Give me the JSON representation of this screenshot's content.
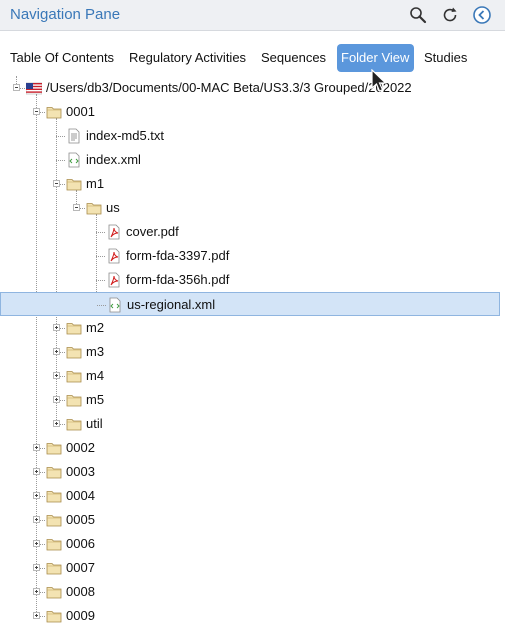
{
  "pane": {
    "title": "Navigation Pane"
  },
  "header_icons": [
    "search-icon",
    "refresh-icon",
    "back-circle-icon"
  ],
  "accent": "#5b97dc",
  "tabs": [
    {
      "label": "Table Of Contents",
      "active": false
    },
    {
      "label": "Regulatory Activities",
      "active": false
    },
    {
      "label": "Sequences",
      "active": false
    },
    {
      "label": "Folder View",
      "active": true
    },
    {
      "label": "Studies",
      "active": false
    }
  ],
  "tree": [
    {
      "label": "/Users/db3/Documents/00-MAC Beta/US3.3/3 Grouped/202022",
      "depth": 0,
      "kind": "us-flag",
      "expanded": true
    },
    {
      "label": "0001",
      "depth": 1,
      "kind": "folder",
      "expanded": true
    },
    {
      "label": "index-md5.txt",
      "depth": 2,
      "kind": "text-file"
    },
    {
      "label": "index.xml",
      "depth": 2,
      "kind": "xml-file"
    },
    {
      "label": "m1",
      "depth": 2,
      "kind": "folder",
      "expanded": true
    },
    {
      "label": "us",
      "depth": 3,
      "kind": "folder",
      "expanded": true
    },
    {
      "label": "cover.pdf",
      "depth": 4,
      "kind": "pdf-file"
    },
    {
      "label": "form-fda-3397.pdf",
      "depth": 4,
      "kind": "pdf-file"
    },
    {
      "label": "form-fda-356h.pdf",
      "depth": 4,
      "kind": "pdf-file"
    },
    {
      "label": "us-regional.xml",
      "depth": 4,
      "kind": "xml-file",
      "selected": true
    },
    {
      "label": "m2",
      "depth": 2,
      "kind": "folder",
      "expanded": false
    },
    {
      "label": "m3",
      "depth": 2,
      "kind": "folder",
      "expanded": false
    },
    {
      "label": "m4",
      "depth": 2,
      "kind": "folder",
      "expanded": false
    },
    {
      "label": "m5",
      "depth": 2,
      "kind": "folder",
      "expanded": false
    },
    {
      "label": "util",
      "depth": 2,
      "kind": "folder",
      "expanded": false
    },
    {
      "label": "0002",
      "depth": 1,
      "kind": "folder",
      "expanded": false
    },
    {
      "label": "0003",
      "depth": 1,
      "kind": "folder",
      "expanded": false
    },
    {
      "label": "0004",
      "depth": 1,
      "kind": "folder",
      "expanded": false
    },
    {
      "label": "0005",
      "depth": 1,
      "kind": "folder",
      "expanded": false
    },
    {
      "label": "0006",
      "depth": 1,
      "kind": "folder",
      "expanded": false
    },
    {
      "label": "0007",
      "depth": 1,
      "kind": "folder",
      "expanded": false
    },
    {
      "label": "0008",
      "depth": 1,
      "kind": "folder",
      "expanded": false
    },
    {
      "label": "0009",
      "depth": 1,
      "kind": "folder",
      "expanded": false
    }
  ]
}
